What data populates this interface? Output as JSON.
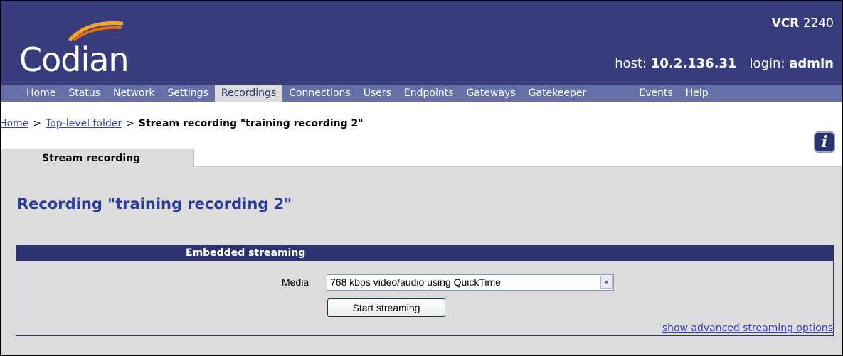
{
  "header": {
    "logo_text": "Codian",
    "product_bold": "VCR",
    "product_model": "2240",
    "host_label": "host:",
    "host_value": "10.2.136.31",
    "login_label": "login:",
    "login_value": "admin"
  },
  "nav": {
    "items": [
      "Home",
      "Status",
      "Network",
      "Settings",
      "Recordings",
      "Connections",
      "Users",
      "Endpoints",
      "Gateways",
      "Gatekeeper",
      "Events",
      "Help"
    ],
    "active": "Recordings"
  },
  "breadcrumb": {
    "home": "Home",
    "folder": "Top-level folder",
    "current": "Stream recording \"training recording 2\"",
    "separator": ">"
  },
  "tabs": {
    "active_tab": "Stream recording"
  },
  "page_title": "Recording \"training recording 2\"",
  "panel": {
    "header": "Embedded streaming",
    "media_label": "Media",
    "media_value": "768 kbps video/audio using QuickTime",
    "start_button": "Start streaming",
    "advanced_link": "show advanced streaming options"
  },
  "colors": {
    "header_bg": "#393c7c",
    "nav_bg": "#6670a8",
    "title_color": "#2e3b9a",
    "link_color": "#3a3ec0",
    "logo_arc": "#f28c1e"
  },
  "icons": {
    "info": "info-icon",
    "dropdown": "chevron-down-icon"
  }
}
